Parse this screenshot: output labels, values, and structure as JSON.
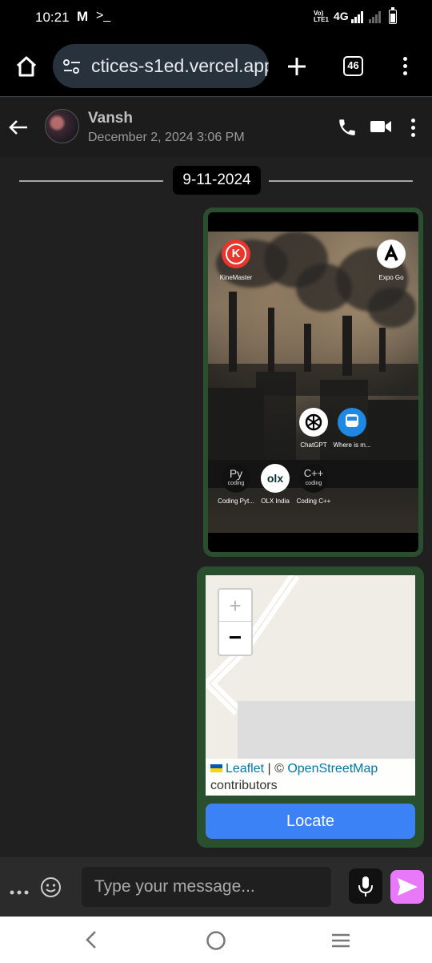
{
  "status_bar": {
    "time": "10:21",
    "network": "4G",
    "volte": "Vo) LTE1"
  },
  "browser": {
    "url": "ctices-s1ed.vercel.app",
    "tab_count": "46"
  },
  "chat_header": {
    "name": "Vansh",
    "last_seen": "December 2, 2024 3:06 PM"
  },
  "chat": {
    "date_separator": "9-11-2024",
    "image_message": {
      "apps": [
        {
          "label": "KineMaster",
          "icon": "kinemaster-icon"
        },
        {
          "label": "Expo Go",
          "icon": "expo-go-icon"
        },
        {
          "label": "ChatGPT",
          "icon": "chatgpt-icon"
        },
        {
          "label": "Where is m...",
          "icon": "train-icon"
        },
        {
          "label": "Coding Pyt...",
          "icon": "python-icon",
          "glyph": "Py",
          "sub": "coding"
        },
        {
          "label": "OLX India",
          "icon": "olx-icon",
          "glyph": "olx"
        },
        {
          "label": "Coding C++",
          "icon": "cpp-icon",
          "glyph": "C++",
          "sub": "coding"
        }
      ]
    },
    "map_message": {
      "zoom_in": "+",
      "zoom_out": "−",
      "attribution": {
        "leaflet": "Leaflet",
        "separator": " | © ",
        "osm": "OpenStreetMap",
        "suffix": "contributors"
      },
      "locate_label": "Locate"
    }
  },
  "composer": {
    "placeholder": "Type your message..."
  },
  "colors": {
    "accent_send": "#e879f9",
    "locate_button": "#3b82f6",
    "bubble_border": "#2a4f2f"
  }
}
